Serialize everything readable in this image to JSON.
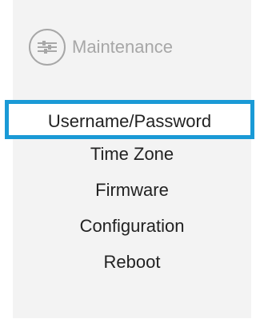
{
  "section": {
    "title": "Maintenance",
    "icon": "settings-sliders-icon"
  },
  "menu": {
    "items": [
      {
        "label": "Username/Password",
        "active": true
      },
      {
        "label": "Time Zone"
      },
      {
        "label": "Firmware"
      },
      {
        "label": "Configuration"
      },
      {
        "label": "Reboot"
      }
    ]
  },
  "colors": {
    "accent": "#1a9ad6",
    "muted": "#a7a7a7",
    "panel_bg": "#f3f3f3",
    "text": "#222222"
  }
}
